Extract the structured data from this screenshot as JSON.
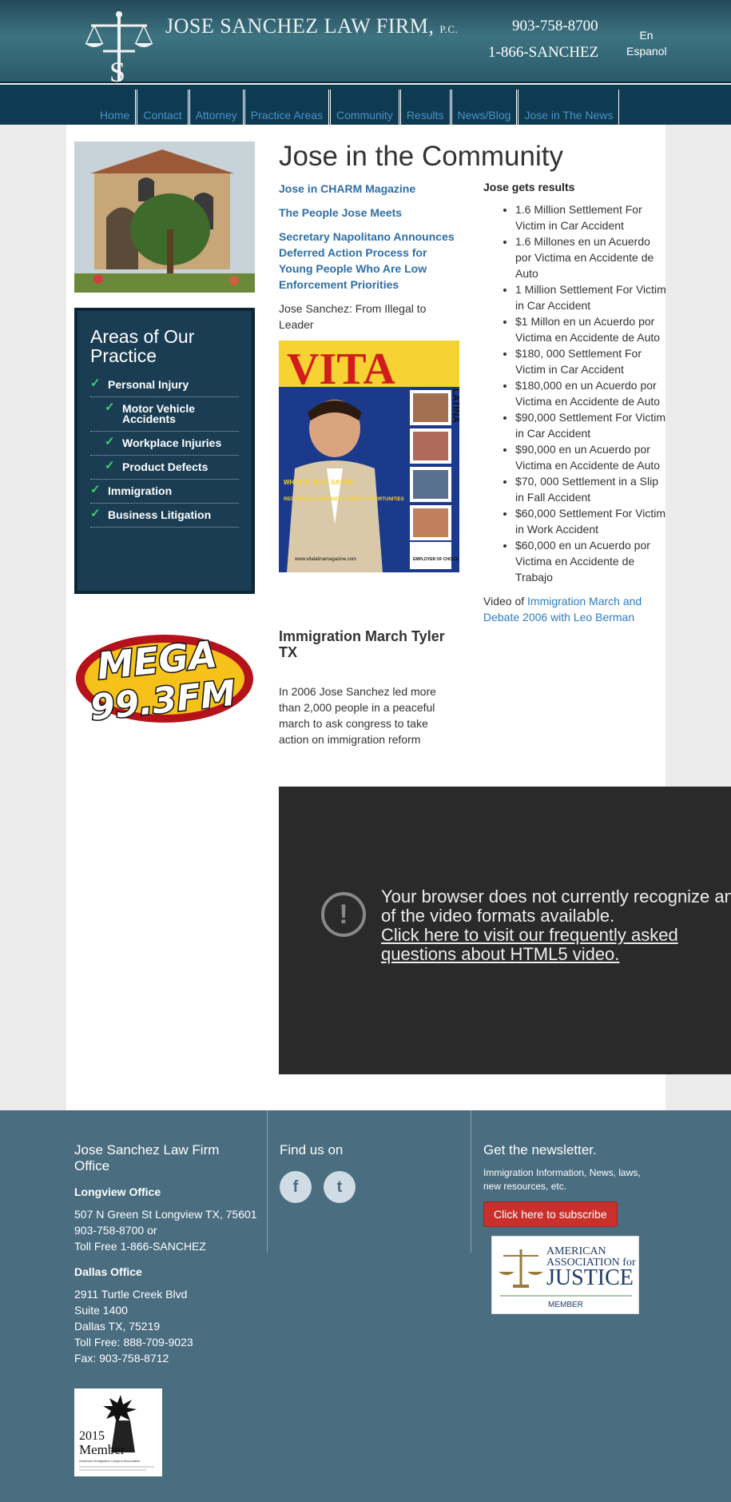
{
  "header": {
    "firm_name": "JOSE SANCHEZ LAW FIRM",
    "firm_suffix": "P.C.",
    "phone_primary": "903-758-8700",
    "phone_secondary": "1-866-SANCHEZ",
    "lang_line1": "En",
    "lang_line2": "Espanol"
  },
  "nav": {
    "items": [
      "Home",
      "Contact",
      "Attorney",
      "Practice Areas",
      "Community",
      "Results",
      "News/Blog",
      "Jose in The News"
    ]
  },
  "sidebar": {
    "areas_title": "Areas of Our Practice",
    "areas": [
      {
        "label": "Personal Injury"
      },
      {
        "label": "Motor Vehicle Accidents"
      },
      {
        "label": "Workplace Injuries"
      },
      {
        "label": "Product Defects"
      },
      {
        "label": "Immigration"
      },
      {
        "label": "Business Litigation"
      }
    ],
    "check_glyph": "✓",
    "mega_logo_text": "MEGA",
    "mega_logo_freq": "99.3FM"
  },
  "main": {
    "title": "Jose in the Community",
    "links": [
      "Jose in CHARM Magazine",
      "The People Jose Meets",
      "Secretary Napolitano Announces Deferred Action Process for Young People Who Are Low Enforcement Priorities"
    ],
    "plain_text": "Jose Sanchez: From Illegal to Leader",
    "magazine": {
      "title": "VITA",
      "subtitle": "LATINA",
      "headline1": "WHAT IS JOSÉ SAYING",
      "headline2": "REP AMERCO PROVIDES CAREER OPPORTUNITIES",
      "footer": "www.vitalatinamagazine.com",
      "badge": "EMPLOYER OF CHOICE"
    },
    "march_title": "Immigration March Tyler TX",
    "march_text": "In 2006 Jose Sanchez led more than 2,000 people in a peaceful march to ask congress to take action on immigration reform",
    "results_title": "Jose gets results",
    "results": [
      "1.6 Million Settlement For Victim in Car Accident",
      "1.6 Millones en un Acuerdo por Victima en Accidente de Auto",
      "1 Million Settlement For Victim in Car Accident",
      "$1 Millon en un Acuerdo por Victima en Accidente de Auto",
      "$180, 000 Settlement For Victim in Car Accident",
      "$180,000 en un Acuerdo por Victima en Accidente de Auto",
      "$90,000 Settlement For Victim in Car Accident",
      "$90,000 en un Acuerdo por Victima en Accidente de Auto",
      "$70, 000 Settlement in a Slip in Fall Accident",
      "$60,000 Settlement For Victim in Work Accident",
      "$60,000 en un Acuerdo por Victima en Accidente de Trabajo"
    ],
    "video_prefix": "Video of ",
    "video_link": "Immigration March and Debate 2006 with Leo Berman",
    "video_error": {
      "icon": "!",
      "line1": "Your browser does not currently recognize any",
      "line2": "of the video formats available.",
      "link1": "Click here to visit our frequently asked",
      "link2": "questions about HTML5 video."
    }
  },
  "footer": {
    "office_title": "Jose Sanchez Law Firm Office",
    "longview_title": "Longview Office",
    "longview_lines": [
      "507 N Green St Longview TX, 75601",
      "903-758-8700 or",
      "Toll Free 1-866-SANCHEZ"
    ],
    "dallas_title": "Dallas Office",
    "dallas_lines": [
      "2911 Turtle Creek Blvd",
      "Suite 1400",
      "Dallas TX, 75219",
      "Toll Free: 888-709-9023",
      "Fax: 903-758-8712"
    ],
    "find_us": "Find us on",
    "facebook_glyph": "f",
    "twitter_glyph": "t",
    "newsletter_title": "Get the newsletter.",
    "newsletter_text": "Immigration Information, News, laws, new resources, etc.",
    "subscribe_label": "Click here to subscribe",
    "aaj_line1": "AMERICAN",
    "aaj_line2": "ASSOCIATION for",
    "aaj_line3": "JUSTICE",
    "aaj_member": "MEMBER",
    "badge_year": "2015",
    "badge_member": "Member",
    "badge_org": "American Immigration Lawyers Association"
  },
  "colors": {
    "header_teal": "#3d7381",
    "nav_blue": "#0e3a52",
    "link_blue": "#2e6ea6",
    "footer_slate": "#4a6d80",
    "subscribe_red": "#c9302c"
  }
}
